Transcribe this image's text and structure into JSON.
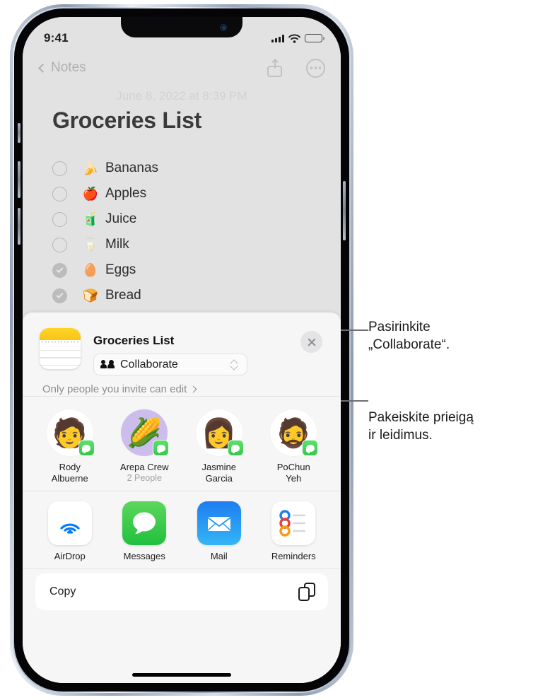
{
  "status_bar": {
    "time": "9:41",
    "signal_icon": "cellular-bars-icon",
    "wifi_icon": "wifi-icon",
    "battery_icon": "battery-full-icon"
  },
  "nav": {
    "back_label": "Notes",
    "back_icon": "chevron-left-icon",
    "share_icon": "share-icon",
    "more_icon": "ellipsis-circle-icon"
  },
  "note": {
    "date": "June 8, 2022 at 8:39 PM",
    "title": "Groceries List",
    "items": [
      {
        "emoji": "🍌",
        "label": "Bananas",
        "checked": false
      },
      {
        "emoji": "🍎",
        "label": "Apples",
        "checked": false
      },
      {
        "emoji": "🧃",
        "label": "Juice",
        "checked": false
      },
      {
        "emoji": "🥛",
        "label": "Milk",
        "checked": false
      },
      {
        "emoji": "🥚",
        "label": "Eggs",
        "checked": true
      },
      {
        "emoji": "🍞",
        "label": "Bread",
        "checked": true
      }
    ]
  },
  "share_sheet": {
    "app_icon": "notes-app-icon",
    "title": "Groceries List",
    "close_icon": "close-icon",
    "collaborate": {
      "icon": "two-people-icon",
      "label": "Collaborate",
      "selector_icon": "up-down-chevron-icon"
    },
    "permission": {
      "label": "Only people you invite can edit",
      "chevron_icon": "chevron-right-icon"
    },
    "contacts": [
      {
        "avatar": "🧑",
        "name_line1": "Rody",
        "name_line2": "Albuerne",
        "sub": "",
        "badge": "messages-badge-icon",
        "purple": false
      },
      {
        "avatar": "🌽",
        "name_line1": "Arepa Crew",
        "name_line2": "",
        "sub": "2 People",
        "badge": "messages-badge-icon",
        "purple": true
      },
      {
        "avatar": "👩",
        "name_line1": "Jasmine",
        "name_line2": "Garcia",
        "sub": "",
        "badge": "messages-badge-icon",
        "purple": false
      },
      {
        "avatar": "🧔",
        "name_line1": "PoChun",
        "name_line2": "Yeh",
        "sub": "",
        "badge": "messages-badge-icon",
        "purple": false
      }
    ],
    "apps": [
      {
        "name": "AirDrop",
        "icon": "airdrop-icon"
      },
      {
        "name": "Messages",
        "icon": "messages-icon"
      },
      {
        "name": "Mail",
        "icon": "mail-icon"
      },
      {
        "name": "Reminders",
        "icon": "reminders-icon"
      }
    ],
    "copy": {
      "label": "Copy",
      "icon": "duplicate-documents-icon"
    }
  },
  "callouts": [
    {
      "line1": "Pasirinkite",
      "line2": "„Collaborate“."
    },
    {
      "line1": "Pakeiskite prieigą",
      "line2": "ir leidimus."
    }
  ],
  "colors": {
    "accent_green": "#35c84a",
    "accent_blue": "#1f7df0",
    "notes_yellow": "#f7c518",
    "sheet_bg": "#f6f6f6",
    "note_bg": "#e2e2e2"
  }
}
